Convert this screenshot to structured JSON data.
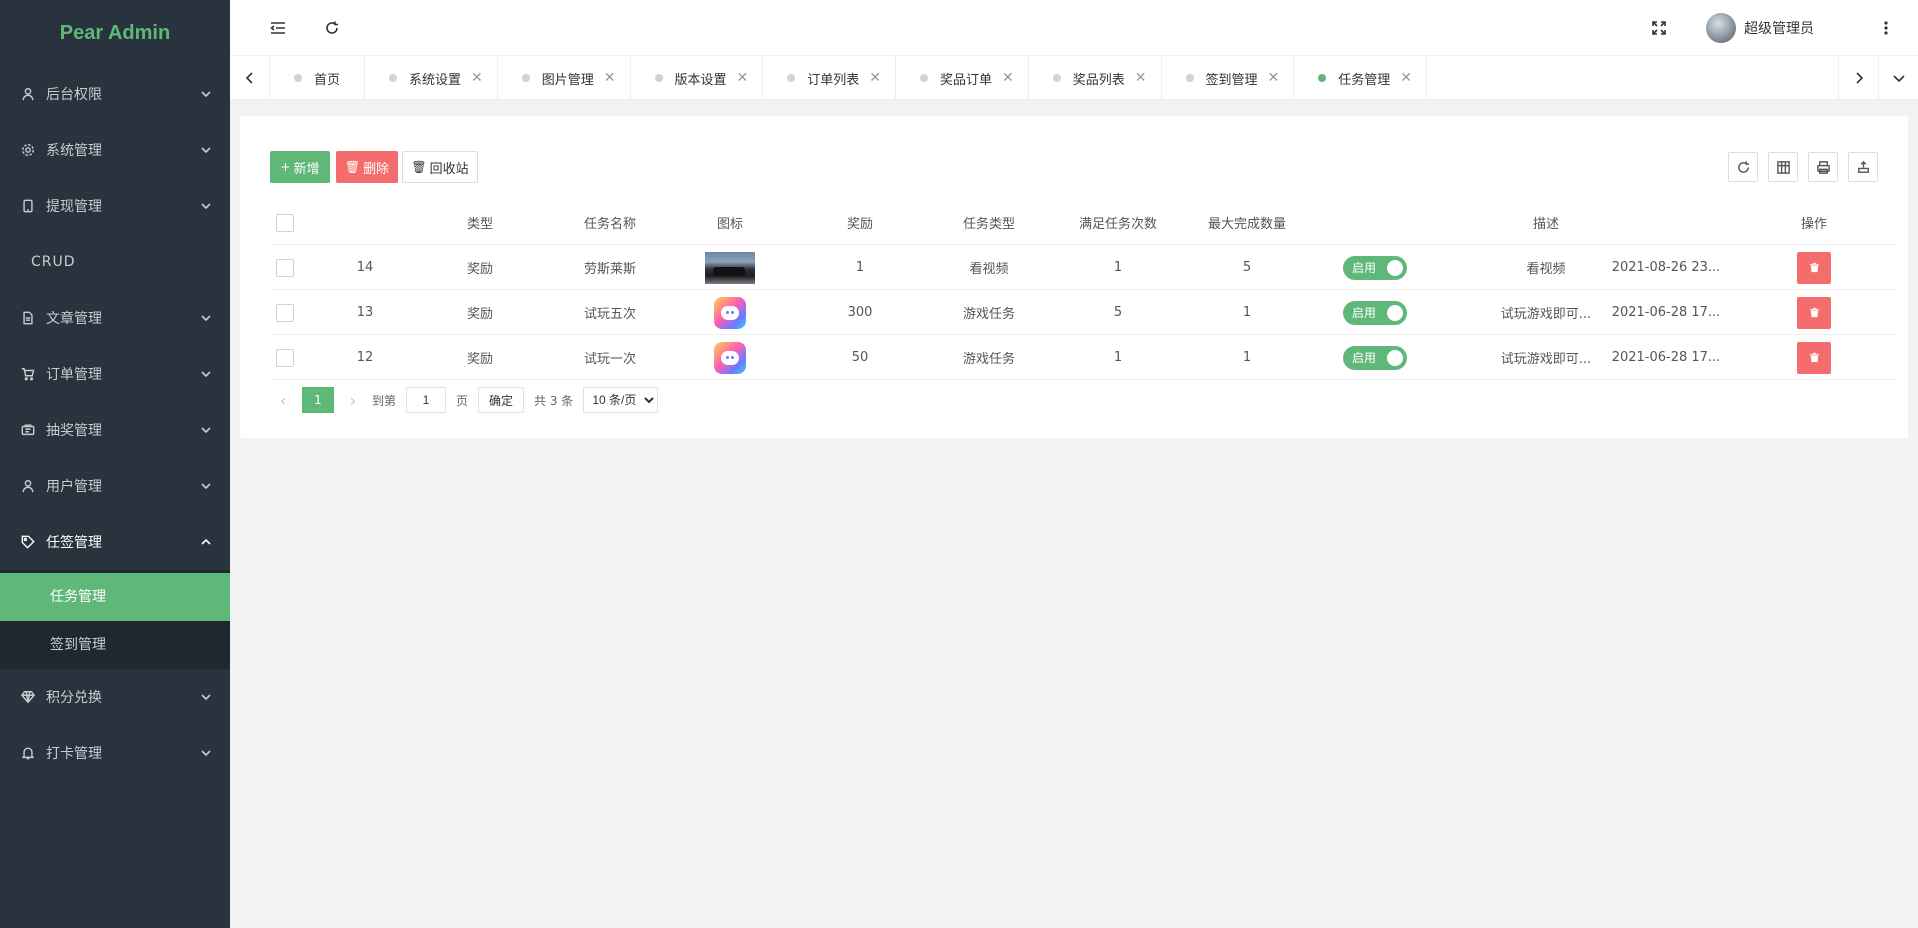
{
  "app": {
    "title": "Pear Admin"
  },
  "sidebar": {
    "items": [
      {
        "label": "后台权限",
        "icon": "user-icon"
      },
      {
        "label": "系统管理",
        "icon": "gear-icon"
      },
      {
        "label": "提现管理",
        "icon": "phone-icon"
      },
      {
        "label": "CRUD"
      },
      {
        "label": "文章管理",
        "icon": "document-icon"
      },
      {
        "label": "订单管理",
        "icon": "cart-icon"
      },
      {
        "label": "抽奖管理",
        "icon": "ticket-icon"
      },
      {
        "label": "用户管理",
        "icon": "user-icon"
      },
      {
        "label": "任签管理",
        "icon": "tag-icon"
      },
      {
        "label": "积分兑换",
        "icon": "diamond-icon"
      },
      {
        "label": "打卡管理",
        "icon": "bell-icon"
      }
    ],
    "submenu": [
      {
        "label": "任务管理",
        "active": true
      },
      {
        "label": "签到管理",
        "active": false
      }
    ]
  },
  "header": {
    "username": "超级管理员"
  },
  "tabs": [
    {
      "label": "首页",
      "closable": false
    },
    {
      "label": "系统设置",
      "closable": true
    },
    {
      "label": "图片管理",
      "closable": true
    },
    {
      "label": "版本设置",
      "closable": true
    },
    {
      "label": "订单列表",
      "closable": true
    },
    {
      "label": "奖品订单",
      "closable": true
    },
    {
      "label": "奖品列表",
      "closable": true
    },
    {
      "label": "签到管理",
      "closable": true
    },
    {
      "label": "任务管理",
      "closable": true,
      "active": true
    }
  ],
  "toolbar": {
    "add_label": "新增",
    "delete_label": "删除",
    "recycle_label": "回收站"
  },
  "table": {
    "columns": [
      "类型",
      "任务名称",
      "图标",
      "奖励",
      "任务类型",
      "满足任务次数",
      "最大完成数量",
      "描述",
      "操作"
    ],
    "rows": [
      {
        "id": "14",
        "type": "奖励",
        "name": "劳斯莱斯",
        "icon": "car-image",
        "reward": "1",
        "task_type": "看视频",
        "times": "1",
        "max": "5",
        "status": "启用",
        "desc": "看视频",
        "date": "2021-08-26 23..."
      },
      {
        "id": "13",
        "type": "奖励",
        "name": "试玩五次",
        "icon": "app-icon-image",
        "reward": "300",
        "task_type": "游戏任务",
        "times": "5",
        "max": "1",
        "status": "启用",
        "desc": "试玩游戏即可...",
        "date": "2021-06-28 17..."
      },
      {
        "id": "12",
        "type": "奖励",
        "name": "试玩一次",
        "icon": "app-icon-image",
        "reward": "50",
        "task_type": "游戏任务",
        "times": "1",
        "max": "1",
        "status": "启用",
        "desc": "试玩游戏即可...",
        "date": "2021-06-28 17..."
      }
    ]
  },
  "pager": {
    "current": "1",
    "goto_label": "到第",
    "goto_value": "1",
    "page_unit": "页",
    "confirm_label": "确定",
    "total": "共 3 条",
    "page_size": "10 条/页"
  },
  "colors": {
    "accent": "#5fb878",
    "danger": "#f56c6c",
    "sidebar": "#28333e"
  }
}
